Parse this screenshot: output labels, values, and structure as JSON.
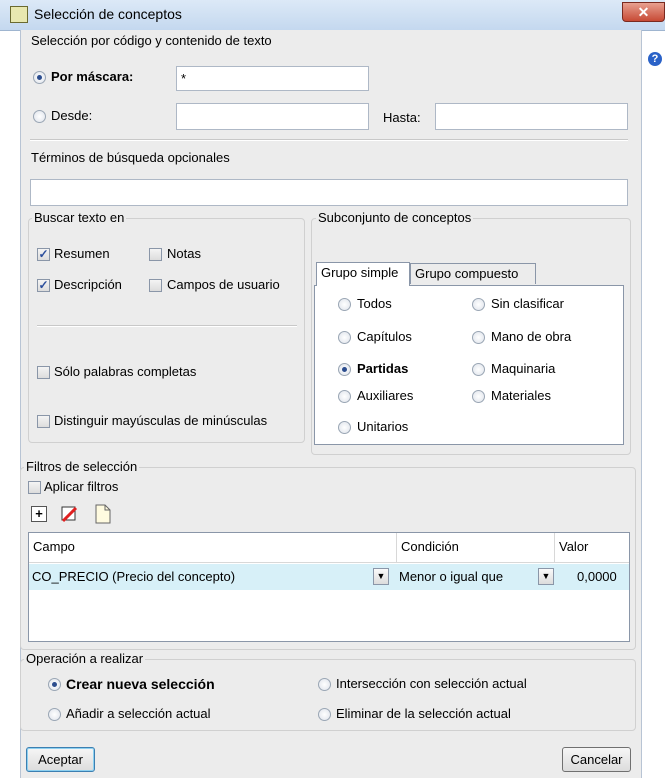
{
  "window": {
    "title": "Selección de conceptos",
    "close": "✕",
    "help": "?"
  },
  "seleccion_codigo": {
    "legend": "Selección por código y contenido de texto",
    "por_mascara_label": "Por máscara:",
    "por_mascara_value": "*",
    "desde_label": "Desde:",
    "hasta_label": "Hasta:",
    "terminos_label": "Términos de búsqueda opcionales"
  },
  "buscar_texto": {
    "legend": "Buscar texto en",
    "resumen": "Resumen",
    "notas": "Notas",
    "descripcion": "Descripción",
    "campos_usuario": "Campos de usuario",
    "solo_palabras": "Sólo palabras completas",
    "distinguir": "Distinguir mayúsculas de minúsculas"
  },
  "subconjunto": {
    "legend": "Subconjunto de conceptos",
    "tab_simple": "Grupo simple",
    "tab_compuesto": "Grupo compuesto",
    "todos": "Todos",
    "capitulos": "Capítulos",
    "partidas": "Partidas",
    "auxiliares": "Auxiliares",
    "unitarios": "Unitarios",
    "sin_clasificar": "Sin clasificar",
    "mano_obra": "Mano de obra",
    "maquinaria": "Maquinaria",
    "materiales": "Materiales"
  },
  "filtros": {
    "legend": "Filtros de selección",
    "aplicar": "Aplicar filtros",
    "col_campo": "Campo",
    "col_condicion": "Condición",
    "col_valor": "Valor",
    "row_campo": "CO_PRECIO (Precio del concepto)",
    "row_condicion": "Menor o igual que",
    "row_valor": "0,0000"
  },
  "operacion": {
    "legend": "Operación a realizar",
    "crear": "Crear nueva selección",
    "anadir": "Añadir a selección actual",
    "interseccion": "Intersección con selección actual",
    "eliminar": "Eliminar de la selección actual"
  },
  "buttons": {
    "aceptar": "Aceptar",
    "cancelar": "Cancelar"
  }
}
